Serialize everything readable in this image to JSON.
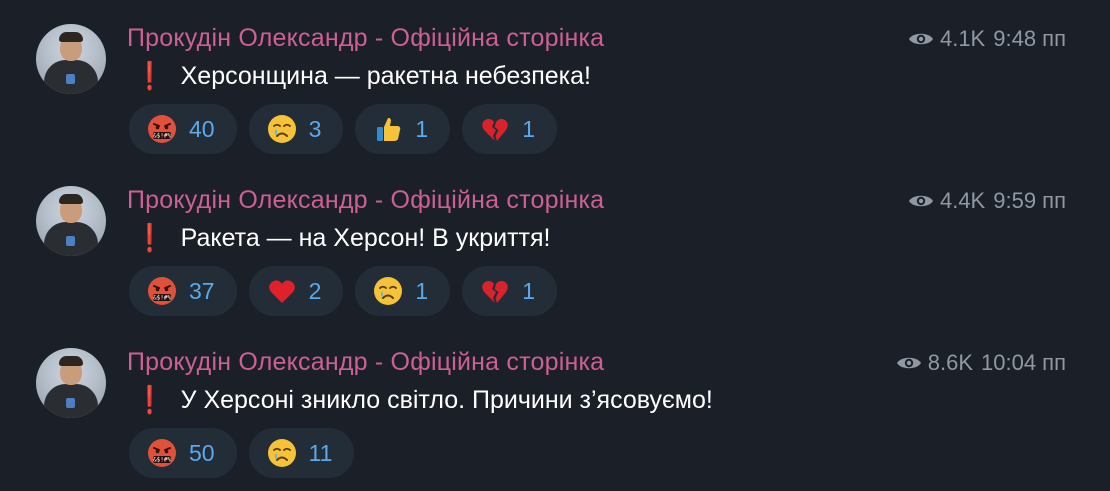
{
  "messages": [
    {
      "author": "Прокудін Олександр - Офіційна сторінка",
      "views": "4.1K",
      "time": "9:48 пп",
      "text": "Херсонщина — ракетна небезпека!",
      "reactions": [
        {
          "emoji": "cursing-face",
          "count": "40"
        },
        {
          "emoji": "crying-face",
          "count": "3"
        },
        {
          "emoji": "thumbs-up",
          "count": "1"
        },
        {
          "emoji": "broken-heart",
          "count": "1"
        }
      ]
    },
    {
      "author": "Прокудін Олександр - Офіційна сторінка",
      "views": "4.4K",
      "time": "9:59 пп",
      "text": "Ракета — на Херсон! В укриття!",
      "reactions": [
        {
          "emoji": "cursing-face",
          "count": "37"
        },
        {
          "emoji": "red-heart",
          "count": "2"
        },
        {
          "emoji": "crying-face",
          "count": "1"
        },
        {
          "emoji": "broken-heart",
          "count": "1"
        }
      ]
    },
    {
      "author": "Прокудін Олександр - Офіційна сторінка",
      "views": "8.6K",
      "time": "10:04 пп",
      "text": "У Херсоні зникло світло. Причини з’ясовуємо!",
      "reactions": [
        {
          "emoji": "cursing-face",
          "count": "50"
        },
        {
          "emoji": "crying-face",
          "count": "11"
        }
      ]
    }
  ],
  "exclamation_glyph": "❗",
  "colors": {
    "background": "#1b2028",
    "author": "#cd5f95",
    "reaction_bg": "#232d38",
    "reaction_count": "#5aa9ec",
    "meta": "#8f98a3"
  }
}
